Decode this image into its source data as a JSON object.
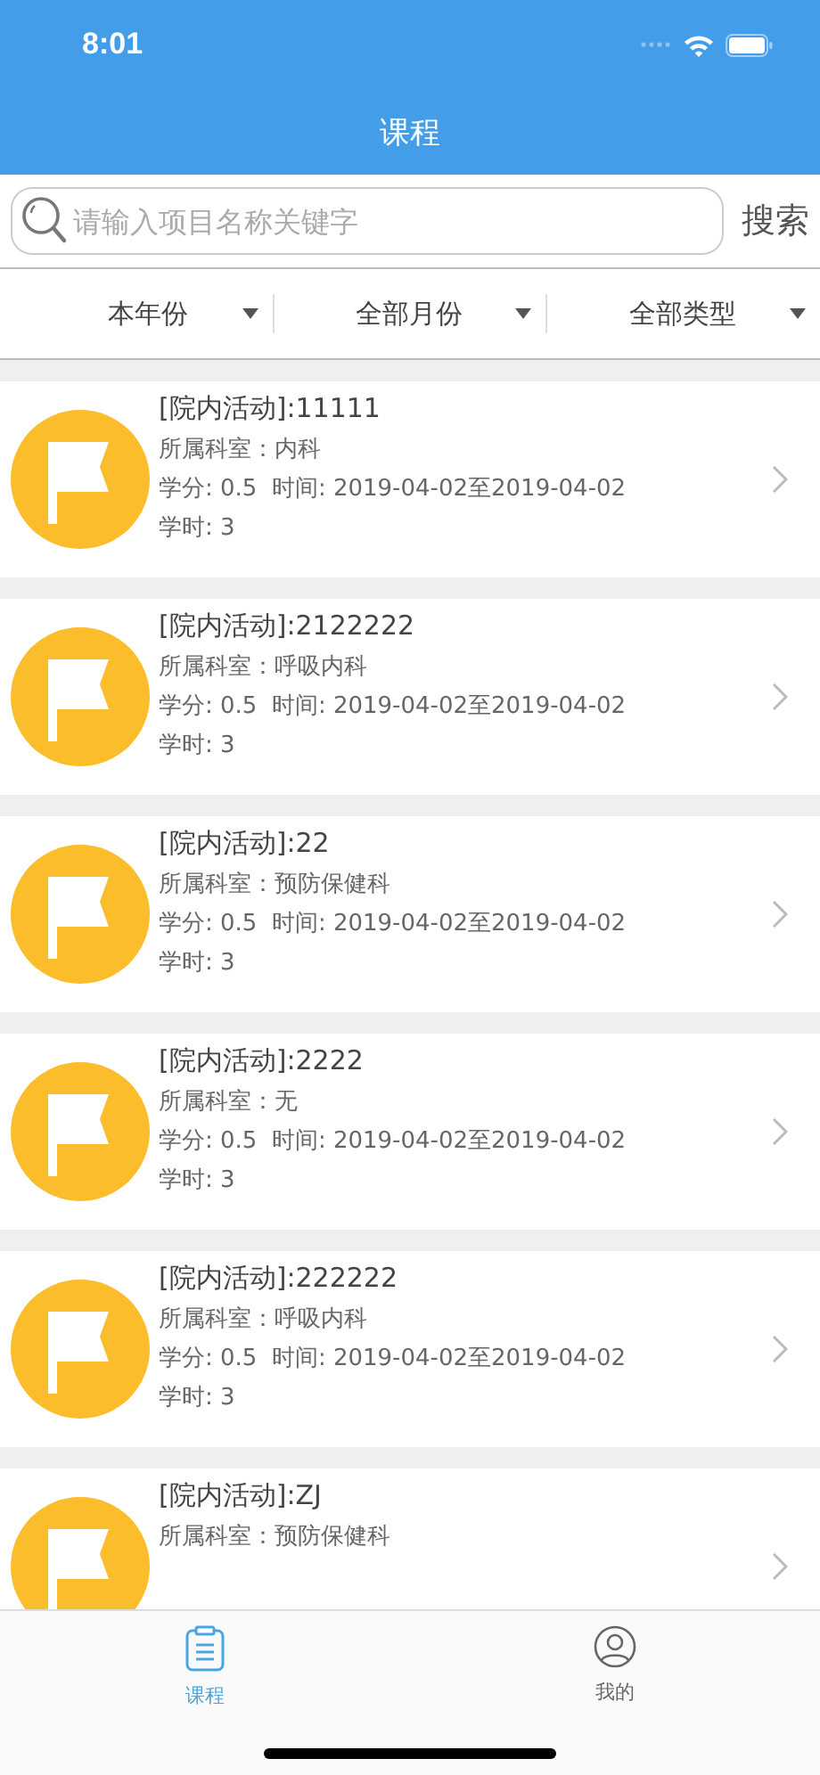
{
  "status_bar": {
    "time": "8:01"
  },
  "nav": {
    "title": "课程"
  },
  "search": {
    "placeholder": "请输入项目名称关键字",
    "button": "搜索"
  },
  "filters": [
    {
      "label": "本年份"
    },
    {
      "label": "全部月份"
    },
    {
      "label": "全部类型"
    }
  ],
  "courses": [
    {
      "title": "[院内活动]:11111",
      "department": "所属科室：内科",
      "details": "学分: 0.5  时间: 2019-04-02至2019-04-02",
      "hours": "学时: 3"
    },
    {
      "title": "[院内活动]:2122222",
      "department": "所属科室：呼吸内科",
      "details": "学分: 0.5  时间: 2019-04-02至2019-04-02",
      "hours": "学时: 3"
    },
    {
      "title": "[院内活动]:22",
      "department": "所属科室：预防保健科",
      "details": "学分: 0.5  时间: 2019-04-02至2019-04-02",
      "hours": "学时: 3"
    },
    {
      "title": "[院内活动]:2222",
      "department": "所属科室：无",
      "details": "学分: 0.5  时间: 2019-04-02至2019-04-02",
      "hours": "学时: 3"
    },
    {
      "title": "[院内活动]:222222",
      "department": "所属科室：呼吸内科",
      "details": "学分: 0.5  时间: 2019-04-02至2019-04-02",
      "hours": "学时: 3"
    },
    {
      "title": "[院内活动]:ZJ",
      "department": "所属科室：预防保健科"
    }
  ],
  "tab_bar": [
    {
      "label": "课程",
      "kind": "courses",
      "selected": true
    },
    {
      "label": "我的",
      "kind": "profile",
      "selected": false
    }
  ]
}
